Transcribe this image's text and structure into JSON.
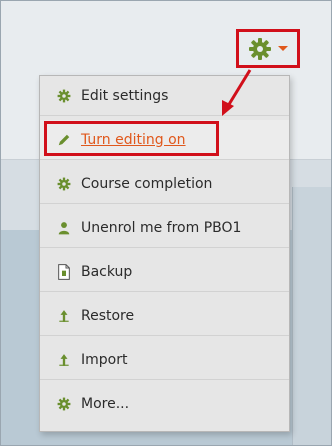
{
  "colors": {
    "accent": "#e0581c",
    "icon_green": "#6a8f2e",
    "highlight_red": "#d10f1a"
  },
  "gear_button": {
    "icon": "gear-icon",
    "caret": "chevron-down-icon"
  },
  "menu": {
    "items": [
      {
        "label": "Edit settings",
        "icon": "gear-icon"
      },
      {
        "label": "Turn editing on",
        "icon": "pencil-icon"
      },
      {
        "label": "Course completion",
        "icon": "gear-icon"
      },
      {
        "label": "Unenrol me from PBO1",
        "icon": "user-icon"
      },
      {
        "label": "Backup",
        "icon": "file-icon"
      },
      {
        "label": "Restore",
        "icon": "upload-icon"
      },
      {
        "label": "Import",
        "icon": "upload-icon"
      },
      {
        "label": "More...",
        "icon": "gear-icon"
      }
    ]
  }
}
